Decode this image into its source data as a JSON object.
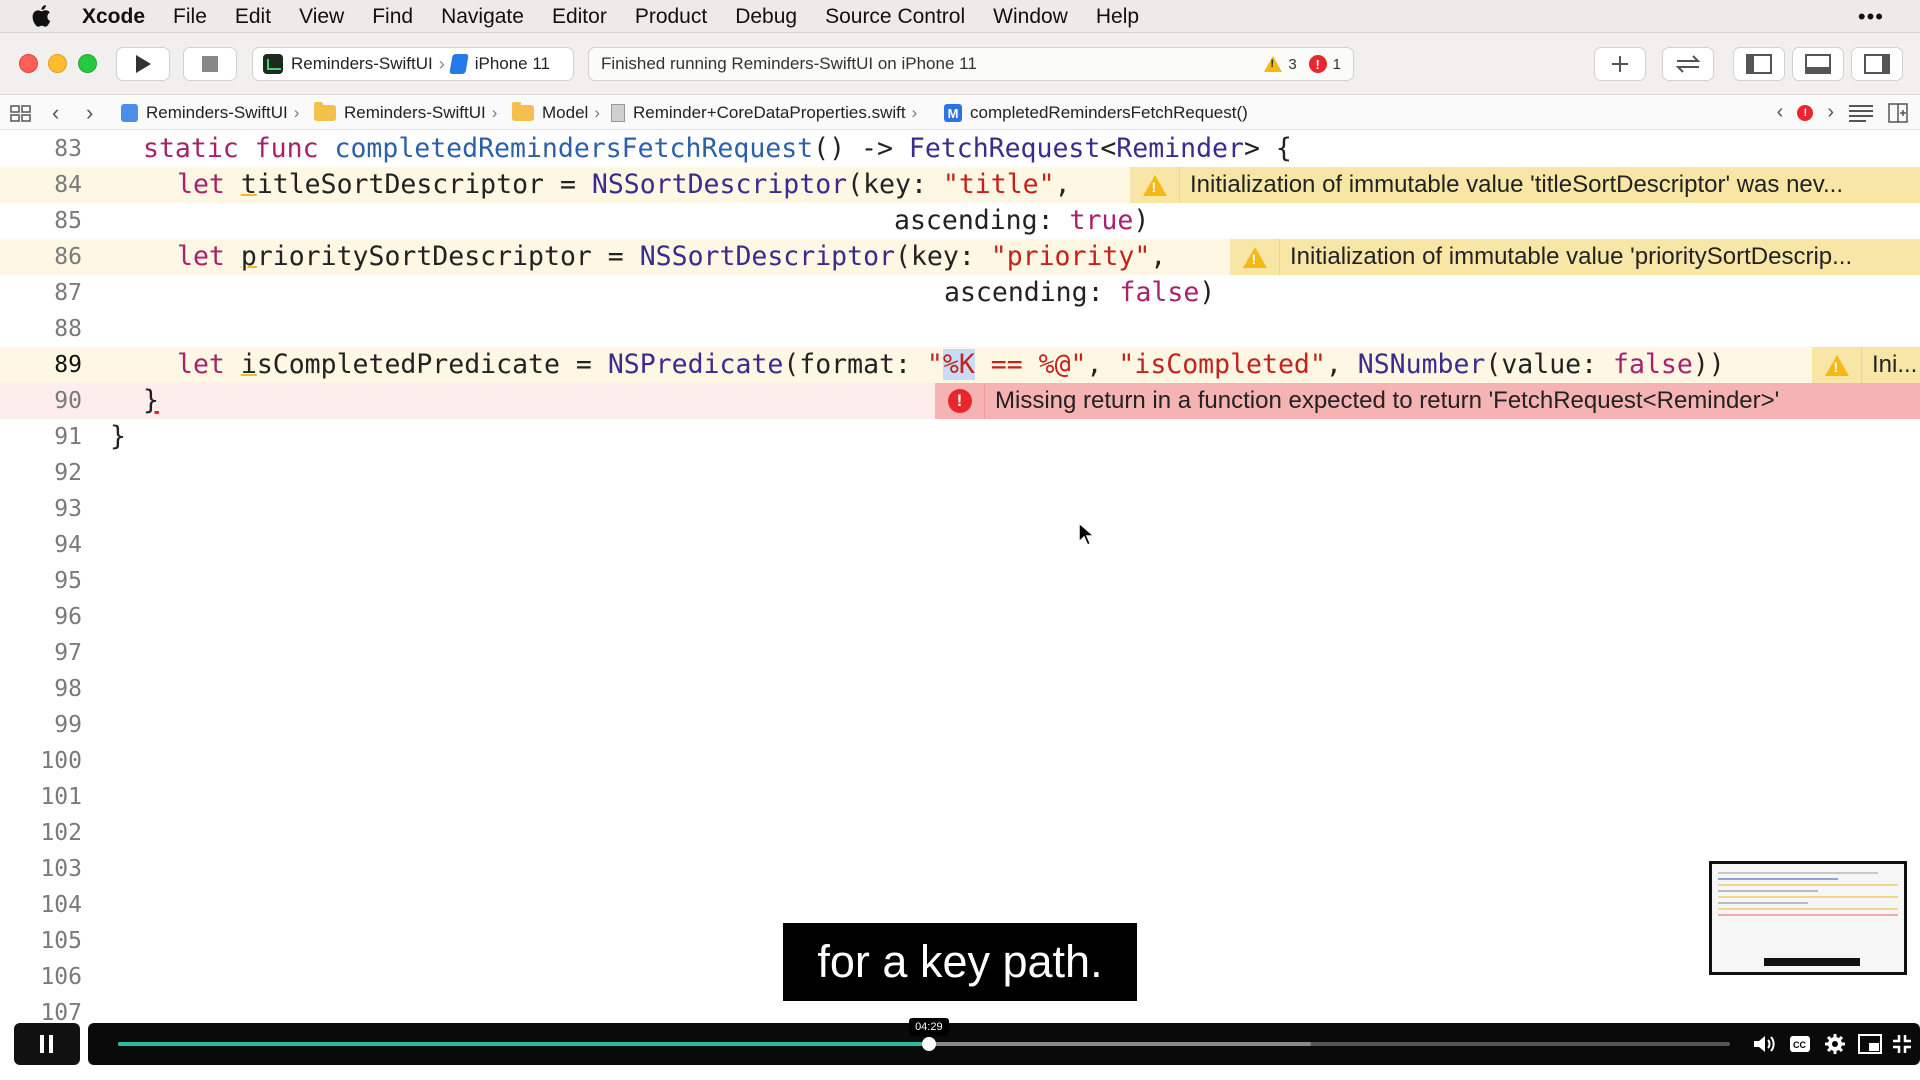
{
  "menubar": {
    "app": "Xcode",
    "items": [
      "File",
      "Edit",
      "View",
      "Find",
      "Navigate",
      "Editor",
      "Product",
      "Debug",
      "Source Control",
      "Window",
      "Help"
    ],
    "more": "•••"
  },
  "toolbar": {
    "scheme_name": "Reminders-SwiftUI",
    "device_name": "iPhone 11",
    "activity": "Finished running Reminders-SwiftUI on iPhone 11",
    "warning_count": "3",
    "error_count": "1"
  },
  "jumpbar": {
    "crumbs": [
      "Reminders-SwiftUI",
      "Reminders-SwiftUI",
      "Model",
      "Reminder+CoreDataProperties.swift",
      "completedRemindersFetchRequest()"
    ]
  },
  "editor": {
    "line_numbers": [
      "83",
      "84",
      "85",
      "86",
      "87",
      "88",
      "89",
      "90",
      "91",
      "92",
      "93",
      "94",
      "95",
      "96",
      "97",
      "98",
      "99",
      "100",
      "101",
      "102",
      "103",
      "104",
      "105",
      "106",
      "107"
    ],
    "issues": {
      "w84": "Initialization of immutable value 'titleSortDescriptor' was nev...",
      "w86": "Initialization of immutable value 'prioritySortDescrip...",
      "w89": "Ini...",
      "e90": "Missing return in a function expected to return 'FetchRequest<Reminder>'"
    },
    "current_line": "89"
  },
  "caption": "for a key path.",
  "player": {
    "time_tooltip": "04:29",
    "progress": 0.503,
    "buffered": 0.74
  },
  "colors": {
    "keyword": "#a8216b",
    "type": "#3b2b8e",
    "function": "#2d5faa",
    "string": "#c4221d",
    "warning_bg": "#f8e6a6",
    "error_bg": "#f6b3b3",
    "progress": "#2ab9a2"
  }
}
